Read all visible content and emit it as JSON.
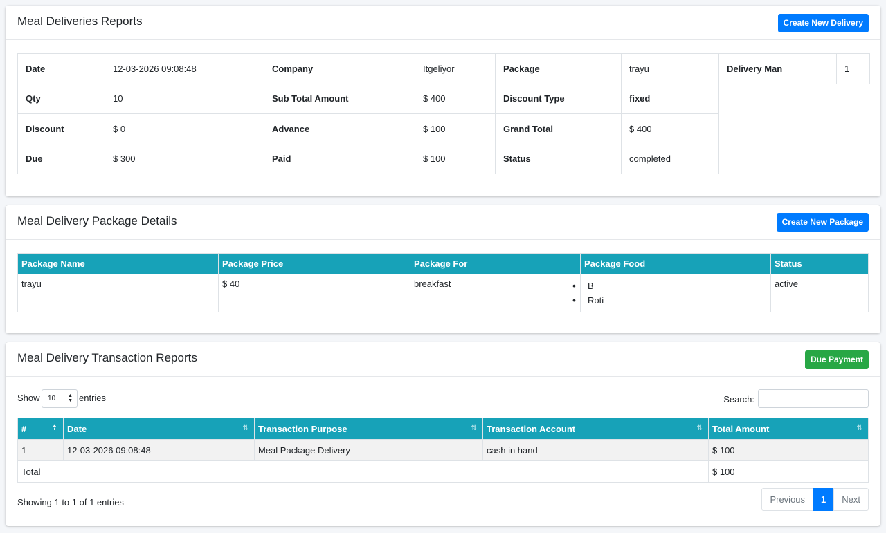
{
  "deliveries": {
    "title": "Meal Deliveries Reports",
    "create_button": "Create New Delivery",
    "rows": [
      [
        {
          "label": "Date",
          "value": "12-03-2026 09:08:48"
        },
        {
          "label": "Company",
          "value": "Itgeliyor"
        },
        {
          "label": "Package",
          "value": "trayu"
        },
        {
          "label": "Delivery Man",
          "value": "1"
        }
      ],
      [
        {
          "label": "Qty",
          "value": "10"
        },
        {
          "label": "Sub Total Amount",
          "value": "$ 400"
        },
        {
          "label": "Discount Type",
          "value": "fixed"
        }
      ],
      [
        {
          "label": "Discount",
          "value": "$ 0"
        },
        {
          "label": "Advance",
          "value": "$ 100"
        },
        {
          "label": "Grand Total",
          "value": "$ 400"
        }
      ],
      [
        {
          "label": "Due",
          "value": "$ 300"
        },
        {
          "label": "Paid",
          "value": "$ 100"
        },
        {
          "label": "Status",
          "value": "completed"
        }
      ]
    ]
  },
  "package": {
    "title": "Meal Delivery Package Details",
    "create_button": "Create New Package",
    "columns": [
      "Package Name",
      "Package Price",
      "Package For",
      "Package Food",
      "Status"
    ],
    "row": {
      "name": "trayu",
      "price": "$ 40",
      "for": "breakfast",
      "food": [
        "B",
        "Roti"
      ],
      "status": "active"
    }
  },
  "transactions": {
    "title": "Meal Delivery Transaction Reports",
    "due_button": "Due Payment",
    "show_label": "Show",
    "entries_value": "10",
    "entries_label": "entries",
    "search_label": "Search:",
    "search_value": "",
    "columns": [
      "#",
      "Date",
      "Transaction Purpose",
      "Transaction Account",
      "Total Amount"
    ],
    "rows": [
      {
        "num": "1",
        "date": "12-03-2026 09:08:48",
        "purpose": "Meal Package Delivery",
        "account": "cash in hand",
        "amount": "$ 100"
      }
    ],
    "total_label": "Total",
    "total_amount": "$ 100",
    "info": "Showing 1 to 1 of 1 entries",
    "pagination": {
      "previous": "Previous",
      "current": "1",
      "next": "Next"
    }
  }
}
